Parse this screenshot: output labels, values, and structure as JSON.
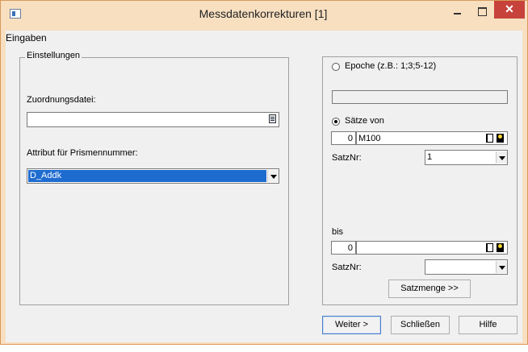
{
  "window": {
    "title": "Messdatenkorrekturen [1]",
    "close_glyph": "✕"
  },
  "menu": {
    "eingaben": "Eingaben"
  },
  "settings": {
    "group_label": "Einstellungen",
    "assignment_file_label": "Zuordnungsdatei:",
    "assignment_file_value": "",
    "prism_attr_label": "Attribut für Prismennummer:",
    "prism_attr_value": "D_Addk"
  },
  "right": {
    "epoch_label": "Epoche (z.B.: 1;3;5-12)",
    "epoch_value": "",
    "epoch_selected": false,
    "saetze_von_label": "Sätze von",
    "saetze_von_selected": true,
    "von_num": "0",
    "von_name": "M100",
    "satznr_label": "SatzNr:",
    "von_satznr_value": "1",
    "bis_label": "bis",
    "bis_num": "0",
    "bis_name": "",
    "bis_satznr_label": "SatzNr:",
    "bis_satznr_value": "",
    "satzmenge_button": "Satzmenge >>"
  },
  "footer": {
    "weiter": "Weiter >",
    "schliessen": "Schließen",
    "hilfe": "Hilfe"
  },
  "icons": {
    "app": "app-icon",
    "file_browse": "document-icon",
    "record_picker": "door-icon",
    "record_search": "key-icon"
  }
}
